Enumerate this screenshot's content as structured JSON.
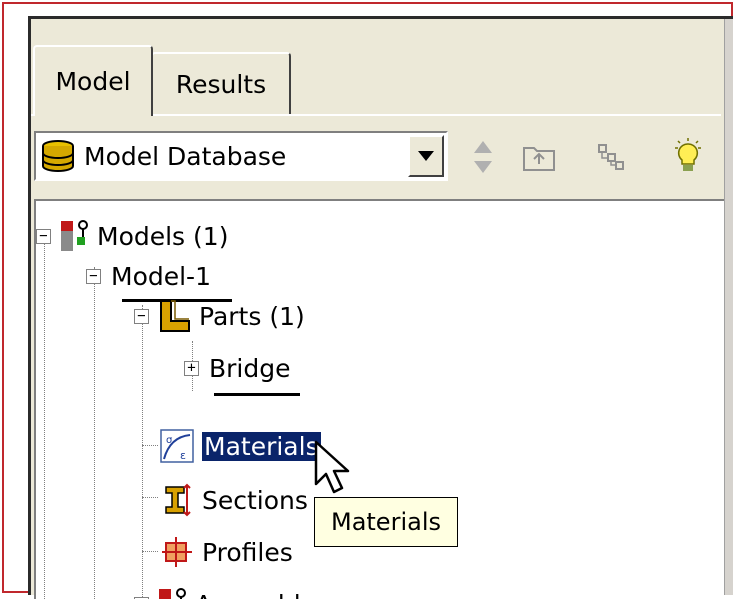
{
  "tabs": [
    {
      "label": "Model",
      "active": true
    },
    {
      "label": "Results",
      "active": false
    }
  ],
  "toolbar": {
    "combo_value": "Model Database",
    "icons": [
      "database-icon",
      "dropdown-arrow-icon",
      "sort-arrows-icon",
      "folder-up-icon",
      "tree-hierarchy-icon",
      "lightbulb-icon"
    ]
  },
  "tree": {
    "models": "Models (1)",
    "model1": "Model-1",
    "parts": "Parts (1)",
    "bridge": "Bridge",
    "materials": "Materials",
    "sections": "Sections",
    "profiles": "Profiles",
    "assembly": "Assembly"
  },
  "tooltip": "Materials",
  "colors": {
    "selection": "#0a246a",
    "tooltip_bg": "#ffffe1",
    "frame": "#c0282d",
    "panel": "#ece9d8"
  }
}
